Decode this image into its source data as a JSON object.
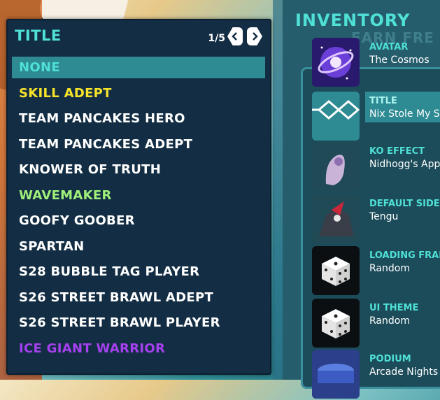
{
  "title_panel": {
    "heading": "TITLE",
    "page_indicator": "1/5",
    "items": [
      {
        "label": "NONE",
        "color": "#4fe0d6",
        "selected": true
      },
      {
        "label": "SKILL ADEPT",
        "color": "#f7e32a"
      },
      {
        "label": "TEAM PANCAKES HERO",
        "color": "#ffffff"
      },
      {
        "label": "TEAM PANCAKES ADEPT",
        "color": "#ffffff"
      },
      {
        "label": "KNOWER OF TRUTH",
        "color": "#ffffff"
      },
      {
        "label": "WAVEMAKER",
        "color": "#9ff07a"
      },
      {
        "label": "GOOFY GOOBER",
        "color": "#ffffff"
      },
      {
        "label": "SPARTAN",
        "color": "#ffffff"
      },
      {
        "label": "S28 BUBBLE TAG PLAYER",
        "color": "#ffffff"
      },
      {
        "label": "S26 STREET BRAWL ADEPT",
        "color": "#ffffff"
      },
      {
        "label": "S26 STREET BRAWL PLAYER",
        "color": "#ffffff"
      },
      {
        "label": "ICE GIANT WARRIOR",
        "color": "#a640f0"
      }
    ]
  },
  "inventory": {
    "heading": "INVENTORY",
    "banner_text": "EARN FRE",
    "slots": [
      {
        "category": "AVATAR",
        "value": "The Cosmos",
        "icon": "cosmos-avatar-icon"
      },
      {
        "category": "TITLE",
        "value": "Nix Stole My S",
        "icon": "title-diamond-icon",
        "active": true
      },
      {
        "category": "KO EFFECT",
        "value": "Nidhogg's App",
        "icon": "ko-effect-icon"
      },
      {
        "category": "DEFAULT SIDEK",
        "value": "Tengu",
        "icon": "tengu-sidekick-icon"
      },
      {
        "category": "LOADING FRAM",
        "value": "Random",
        "icon": "dice-icon"
      },
      {
        "category": "UI THEME",
        "value": "Random",
        "icon": "dice-icon"
      },
      {
        "category": "PODIUM",
        "value": "Arcade Nights",
        "icon": "podium-icon"
      }
    ]
  }
}
